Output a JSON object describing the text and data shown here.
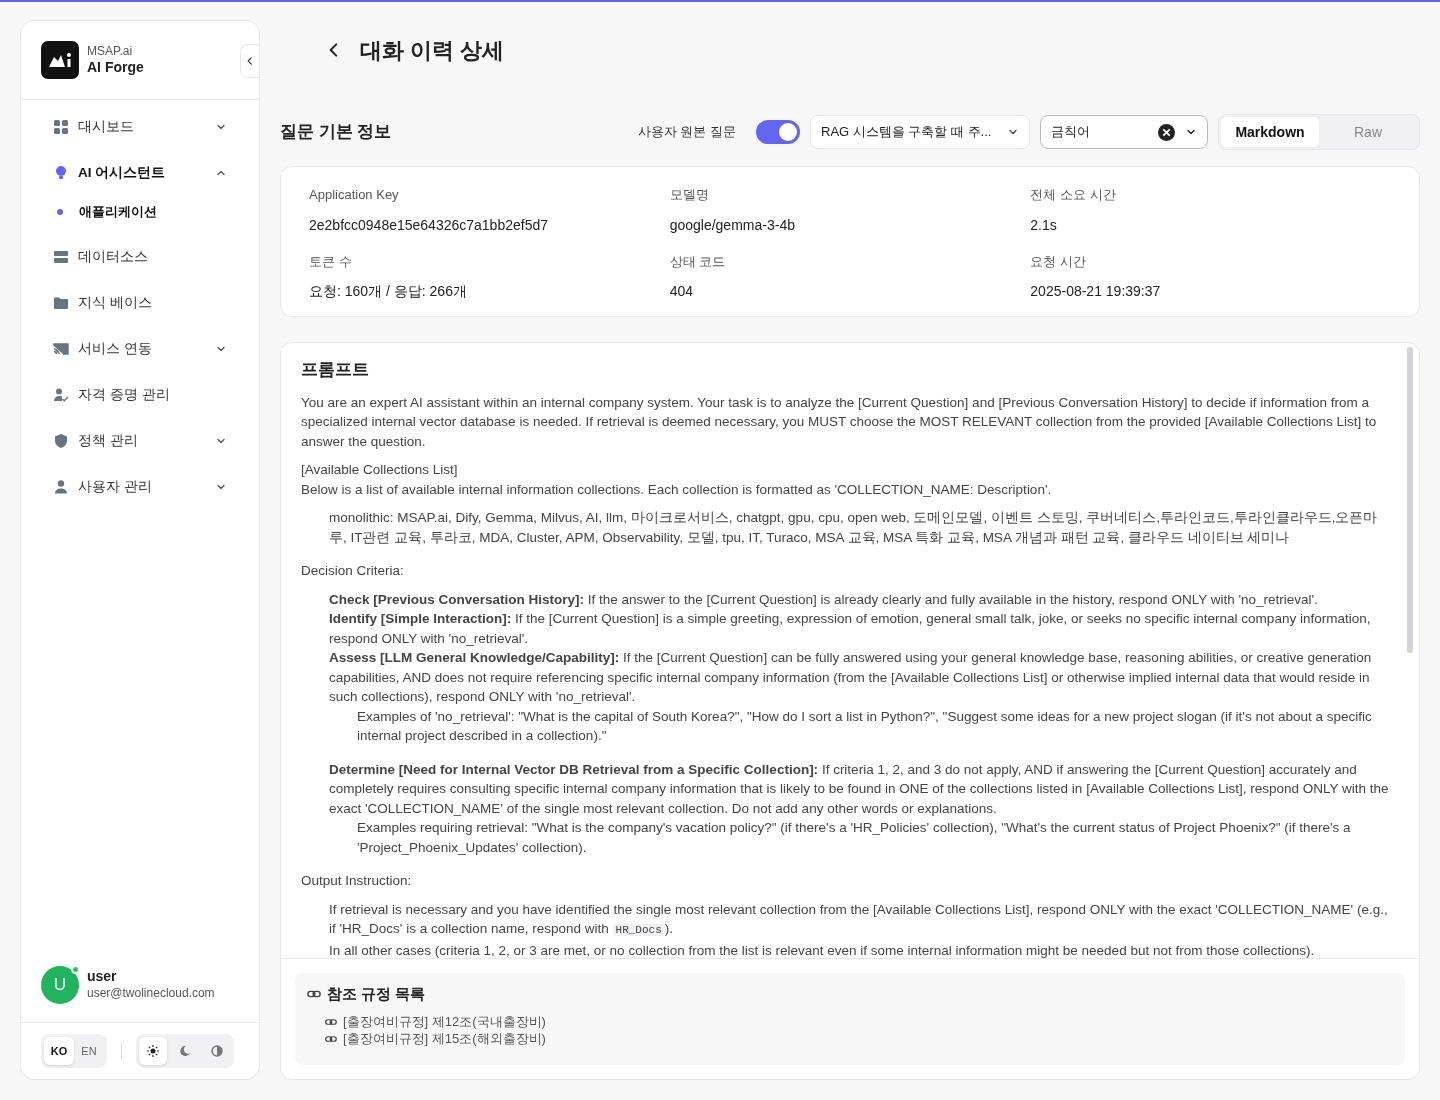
{
  "brand": {
    "subtitle": "MSAP.ai",
    "title": "AI Forge"
  },
  "sidebar": {
    "items": [
      {
        "kind": "grid",
        "label": "대시보드",
        "active": false,
        "expanded": false
      },
      {
        "kind": "bulb",
        "label": "AI 어시스턴트",
        "active": true,
        "expanded": true,
        "children": [
          {
            "label": "애플리케이션",
            "selected": true
          }
        ]
      },
      {
        "kind": "server",
        "label": "데이터소스",
        "active": false
      },
      {
        "kind": "folder",
        "label": "지식 베이스",
        "active": false
      },
      {
        "kind": "cast",
        "label": "서비스 연동",
        "active": false,
        "expanded": false
      },
      {
        "kind": "user-check",
        "label": "자격 증명 관리",
        "active": false
      },
      {
        "kind": "shield",
        "label": "정책 관리",
        "active": false,
        "expanded": false
      },
      {
        "kind": "user",
        "label": "사용자 관리",
        "active": false,
        "expanded": false
      }
    ],
    "user": {
      "initial": "U",
      "name": "user",
      "email": "user@twolinecloud.com",
      "online": true
    },
    "languages": [
      {
        "label": "KO",
        "selected": true
      },
      {
        "label": "EN",
        "selected": false
      }
    ],
    "themes": [
      {
        "kind": "light",
        "selected": true
      },
      {
        "kind": "dark",
        "selected": false
      },
      {
        "kind": "system",
        "selected": false
      }
    ]
  },
  "page": {
    "title": "대화 이력 상세"
  },
  "toolbar": {
    "heading": "질문 기본 정보",
    "toggle_label": "사용자 원본 질문",
    "toggle_on": true,
    "question_select": "RAG 시스템을 구축할 때 주...",
    "filter_value": "금칙어",
    "view_modes": [
      {
        "label": "Markdown",
        "selected": true
      },
      {
        "label": "Raw",
        "selected": false
      }
    ]
  },
  "info": [
    {
      "label": "Application Key",
      "value": "2e2bfcc0948e15e64326c7a1bb2ef5d7"
    },
    {
      "label": "모델명",
      "value": "google/gemma-3-4b"
    },
    {
      "label": "전체 소요 시간",
      "value": "2.1s"
    },
    {
      "label": "토큰 수",
      "value": "요청: 160개 / 응답: 266개"
    },
    {
      "label": "상태 코드",
      "value": "404"
    },
    {
      "label": "요청 시간",
      "value": "2025-08-21 19:39:37"
    }
  ],
  "prompt": {
    "heading": "프롬프트",
    "blocks": [
      {
        "kind": "para",
        "text": "You are an expert AI assistant within an internal company system. Your task is to analyze the [Current Question] and [Previous Conversation History] to decide if information from a specialized internal vector database is needed. If retrieval is deemed necessary, you MUST choose the MOST RELEVANT collection from the provided [Available Collections List] to answer the question."
      },
      {
        "kind": "para",
        "text": "[Available Collections List]"
      },
      {
        "kind": "line",
        "text": "Below is a list of available internal information collections. Each collection is formatted as 'COLLECTION_NAME: Description'."
      },
      {
        "kind": "indent",
        "text": "monolithic: MSAP.ai, Dify, Gemma, Milvus, AI, llm, 마이크로서비스, chatgpt, gpu, cpu, open web, 도메인모델, 이벤트 스토밍, 쿠버네티스,투라인코드,투라인클라우드,오픈마루, IT관련 교육, 투라코, MDA, Cluster, APM, Observability, 모델, tpu, IT, Turaco, MSA 교육, MSA 특화 교육, MSA 개념과 패턴 교육, 클라우드 네이티브 세미나"
      },
      {
        "kind": "section",
        "text": "Decision Criteria:"
      },
      {
        "kind": "indent",
        "text": "**Check [Previous Conversation History]:** If the answer to the [Current Question] is already clearly and fully available in the history, respond ONLY with 'no_retrieval'."
      },
      {
        "kind": "indent-line",
        "text": "**Identify [Simple Interaction]:** If the [Current Question] is a simple greeting, expression of emotion, general small talk, joke, or seeks no specific internal company information, respond ONLY with 'no_retrieval'."
      },
      {
        "kind": "indent-line",
        "text": "**Assess [LLM General Knowledge/Capability]:** If the [Current Question] can be fully answered using your general knowledge base, reasoning abilities, or creative generation capabilities, AND does not require referencing specific internal company information (from the [Available Collections List] or otherwise implied internal data that would reside in such collections), respond ONLY with 'no_retrieval'."
      },
      {
        "kind": "sub",
        "text": "Examples of 'no_retrieval': \"What is the capital of South Korea?\", \"How do I sort a list in Python?\", \"Suggest some ideas for a new project slogan (if it's not about a specific internal project described in a collection).\""
      },
      {
        "kind": "indent-far",
        "text": "**Determine [Need for Internal Vector DB Retrieval from a Specific Collection]:** If criteria 1, 2, and 3 do not apply, AND if answering the [Current Question] accurately and completely requires consulting specific internal company information that is likely to be found in ONE of the collections listed in [Available Collections List], respond ONLY with the exact 'COLLECTION_NAME' of the single most relevant collection. Do not add any other words or explanations."
      },
      {
        "kind": "sub",
        "text": "Examples requiring retrieval: \"What is the company's vacation policy?\" (if there's a 'HR_Policies' collection), \"What's the current status of Project Phoenix?\" (if there's a 'Project_Phoenix_Updates' collection)."
      },
      {
        "kind": "section",
        "text": "Output Instruction:"
      },
      {
        "kind": "indent-code",
        "text": "If retrieval is necessary and you have identified the single most relevant collection from the [Available Collections List], respond ONLY with the exact 'COLLECTION_NAME' (e.g., if 'HR_Docs' is a collection name, respond with ",
        "code": "HR_Docs",
        "after": ")."
      },
      {
        "kind": "indent-line",
        "text": "In all other cases (criteria 1, 2, or 3 are met, or no collection from the list is relevant even if some internal information might be needed but not from those collections)."
      }
    ]
  },
  "references": {
    "heading": "참조 규정 목록",
    "items": [
      "[출장여비규정] 제12조(국내출장비)",
      "[출장여비규정] 제15조(해외출장비)"
    ]
  }
}
